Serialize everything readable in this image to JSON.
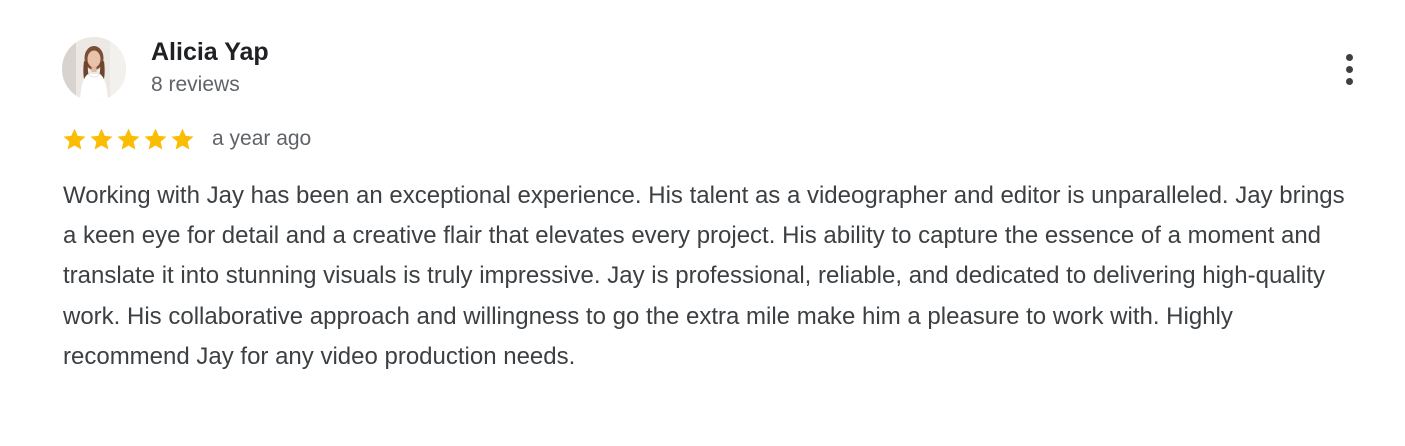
{
  "review": {
    "author": {
      "name": "Alicia Yap",
      "review_count": "8 reviews",
      "avatar_icon": "profile-photo"
    },
    "rating": {
      "value": 5,
      "max": 5,
      "star_color": "#fbbc04"
    },
    "date": "a year ago",
    "text": "Working with Jay has been an exceptional experience. His talent as a videographer and editor is unparalleled. Jay brings a keen eye for detail and a creative flair that elevates every project. His ability to capture the essence of a moment and translate it into stunning visuals is truly impressive. Jay is professional, reliable, and dedicated to delivering high-quality work. His collaborative approach and willingness to go the extra mile make him a pleasure to work with. Highly recommend Jay for any video production needs.",
    "menu_icon": "more-vert-icon"
  }
}
